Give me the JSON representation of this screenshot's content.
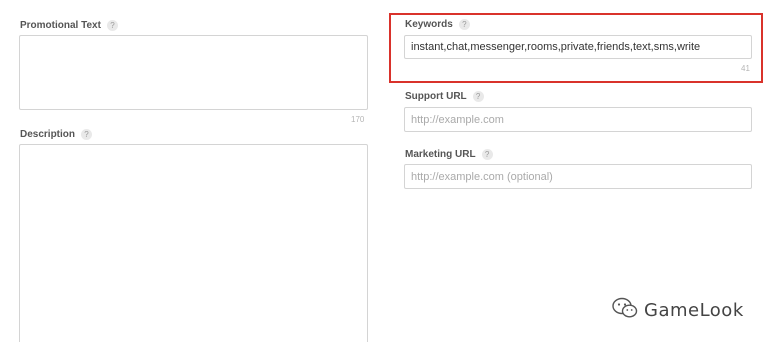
{
  "promotional_text": {
    "label": "Promotional Text",
    "help": "?",
    "counter": "170"
  },
  "description": {
    "label": "Description",
    "help": "?"
  },
  "keywords": {
    "label": "Keywords",
    "help": "?",
    "value": "instant,chat,messenger,rooms,private,friends,text,sms,write",
    "counter": "41",
    "highlight_color": "#d9322b"
  },
  "support_url": {
    "label": "Support URL",
    "help": "?",
    "placeholder": "http://example.com"
  },
  "marketing_url": {
    "label": "Marketing URL",
    "help": "?",
    "placeholder": "http://example.com (optional)"
  },
  "watermark": {
    "text": "GameLook",
    "icon": "wechat-icon"
  }
}
